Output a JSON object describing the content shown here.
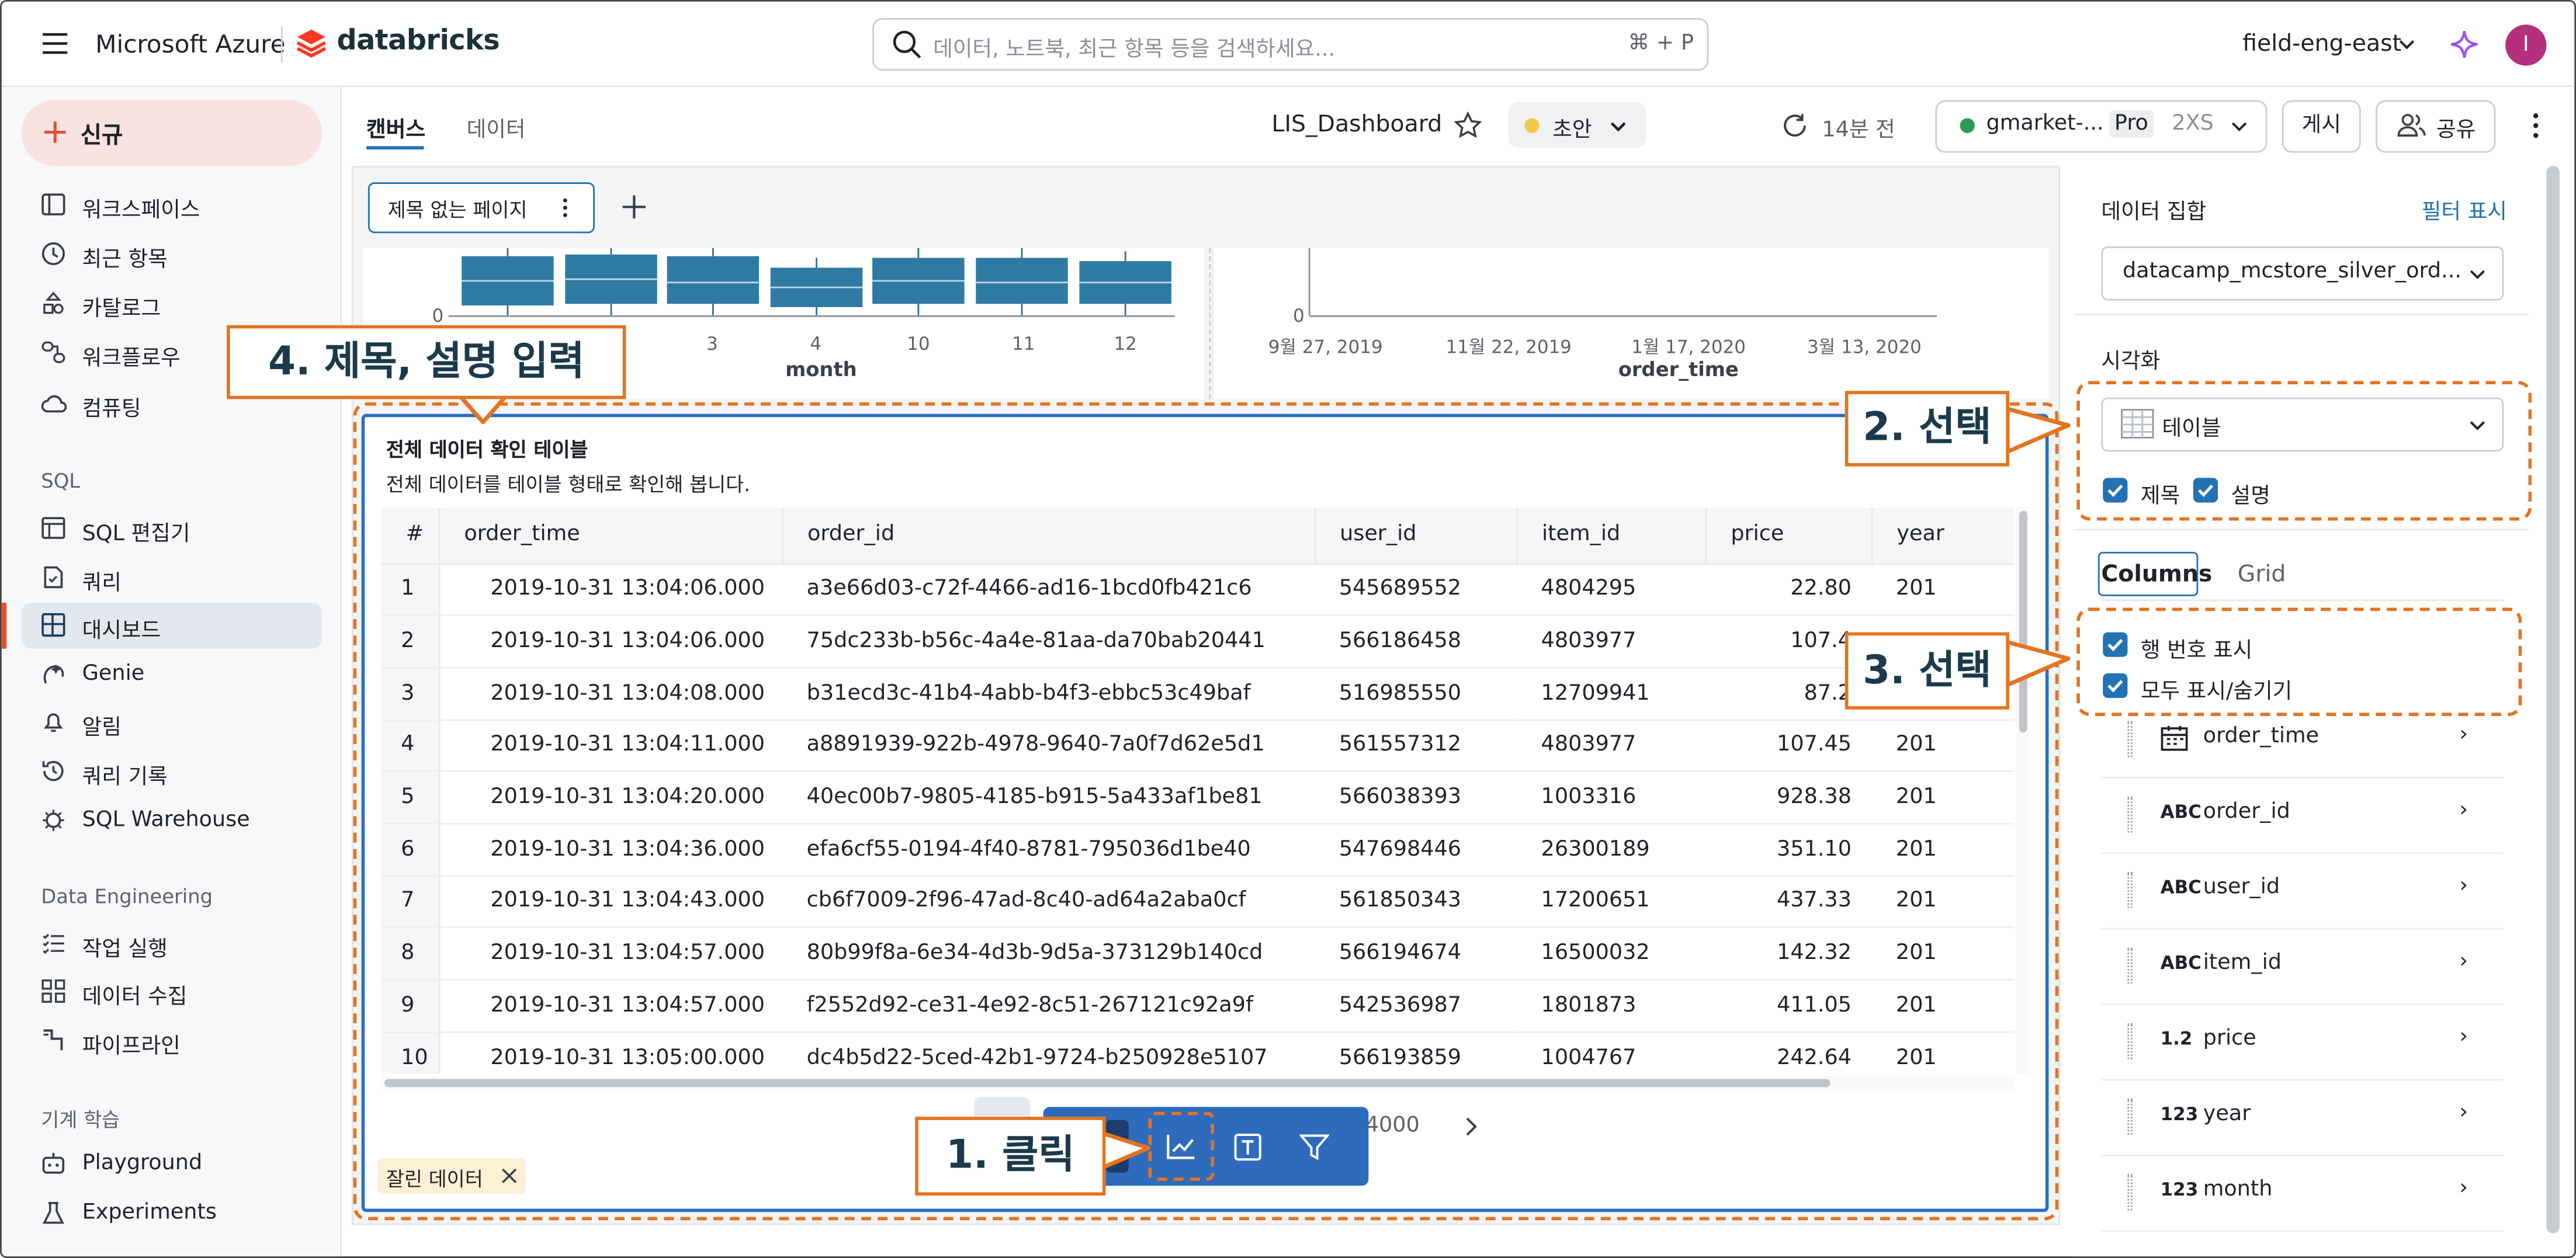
{
  "topbar": {
    "brand_azure": "Microsoft Azure",
    "brand_databricks": "databricks",
    "search_placeholder": "데이터, 노트북, 최근 항목 등을 검색하세요...",
    "search_shortcut": "⌘ + P",
    "workspace": "field-eng-east",
    "avatar_initial": "I"
  },
  "sidebar": {
    "new_label": "신규",
    "items_main": [
      {
        "label": "워크스페이스",
        "icon": "folder-icon"
      },
      {
        "label": "최근 항목",
        "icon": "clock-icon"
      },
      {
        "label": "카탈로그",
        "icon": "catalog-icon"
      },
      {
        "label": "워크플로우",
        "icon": "workflow-icon"
      },
      {
        "label": "컴퓨팅",
        "icon": "cloud-icon"
      }
    ],
    "section_sql": "SQL",
    "items_sql": [
      {
        "label": "SQL 편집기",
        "icon": "editor-icon"
      },
      {
        "label": "쿼리",
        "icon": "query-icon"
      },
      {
        "label": "대시보드",
        "icon": "dashboard-icon"
      },
      {
        "label": "Genie",
        "icon": "genie-icon"
      },
      {
        "label": "알림",
        "icon": "bell-icon"
      },
      {
        "label": "쿼리 기록",
        "icon": "history-icon"
      },
      {
        "label": "SQL Warehouse",
        "icon": "warehouse-icon"
      }
    ],
    "section_de": "Data Engineering",
    "items_de": [
      {
        "label": "작업 실행",
        "icon": "list-check-icon"
      },
      {
        "label": "데이터 수집",
        "icon": "ingest-icon"
      },
      {
        "label": "파이프라인",
        "icon": "pipeline-icon"
      }
    ],
    "section_ml": "기계 학습",
    "items_ml": [
      {
        "label": "Playground",
        "icon": "robot-icon"
      },
      {
        "label": "Experiments",
        "icon": "flask-icon"
      }
    ]
  },
  "header": {
    "tab_canvas": "캔버스",
    "tab_data": "데이터",
    "dashboard_title": "LIS_Dashboard",
    "draft_label": "초안",
    "refresh_label": "14분 전",
    "warehouse_name": "gmarket-...",
    "warehouse_tier": "Pro",
    "warehouse_size": "2XS",
    "publish_label": "게시",
    "share_label": "공유"
  },
  "canvas": {
    "page_tab_label": "제목 없는 페이지",
    "box_chart": {
      "x_label": "month",
      "x_ticks": [
        "3",
        "4",
        "10",
        "11",
        "12"
      ],
      "y_zero": "0"
    },
    "time_chart": {
      "x_label": "order_time",
      "x_ticks": [
        "9월 27, 2019",
        "11월 22, 2019",
        "1월 17, 2020",
        "3월 13, 2020"
      ],
      "y_zero": "0"
    },
    "table_widget": {
      "title": "전체 데이터 확인 테이블",
      "description": "전체 데이터를 테이블 형태로 확인해 봅니다.",
      "columns": [
        "#",
        "order_time",
        "order_id",
        "user_id",
        "item_id",
        "price",
        "year"
      ],
      "rows": [
        [
          "1",
          "2019-10-31 13:04:06.000",
          "a3e66d03-c72f-4466-ad16-1bcd0fb421c6",
          "545689552",
          "4804295",
          "22.80",
          "201"
        ],
        [
          "2",
          "2019-10-31 13:04:06.000",
          "75dc233b-b56c-4a4e-81aa-da70bab20441",
          "566186458",
          "4803977",
          "107.4",
          ""
        ],
        [
          "3",
          "2019-10-31 13:04:08.000",
          "b31ecd3c-41b4-4abb-b4f3-ebbc53c49baf",
          "516985550",
          "12709941",
          "87.2",
          ""
        ],
        [
          "4",
          "2019-10-31 13:04:11.000",
          "a8891939-922b-4978-9640-7a0f7d62e5d1",
          "561557312",
          "4803977",
          "107.45",
          "201"
        ],
        [
          "5",
          "2019-10-31 13:04:20.000",
          "40ec00b7-9805-4185-b915-5a433af1be81",
          "566038393",
          "1003316",
          "928.38",
          "201"
        ],
        [
          "6",
          "2019-10-31 13:04:36.000",
          "efa6cf55-0194-4f40-8781-795036d1be40",
          "547698446",
          "26300189",
          "351.10",
          "201"
        ],
        [
          "7",
          "2019-10-31 13:04:43.000",
          "cb6f7009-2f96-47ad-8c40-ad64a2aba0cf",
          "561850343",
          "17200651",
          "437.33",
          "201"
        ],
        [
          "8",
          "2019-10-31 13:04:57.000",
          "80b99f8a-6e34-4d3b-9d5a-373129b140cd",
          "566194674",
          "16500032",
          "142.32",
          "201"
        ],
        [
          "9",
          "2019-10-31 13:04:57.000",
          "f2552d92-ce31-4e92-8c51-267121c92a9f",
          "542536987",
          "1801873",
          "411.05",
          "201"
        ],
        [
          "10",
          "2019-10-31 13:05:00.000",
          "dc4b5d22-5ced-42b1-9724-b250928e5107",
          "566193859",
          "1004767",
          "242.64",
          "201"
        ]
      ],
      "pagination_partial": "4000",
      "filter_chip": "잘린 데이터"
    }
  },
  "right_panel": {
    "dataset_label": "데이터 집합",
    "filter_link": "필터 표시",
    "dataset_value": "datacamp_mcstore_silver_ord...",
    "viz_label": "시각화",
    "viz_value": "테이블",
    "check_title": "제목",
    "check_desc": "설명",
    "tab_columns": "Columns",
    "tab_grid": "Grid",
    "check_row_numbers": "행 번호 표시",
    "check_show_hide_all": "모두 표시/숨기기",
    "columns": [
      {
        "name": "order_time",
        "type_icon": "calendar-icon",
        "type_label": ""
      },
      {
        "name": "order_id",
        "type_icon": "string-type-icon",
        "type_label": "ABC"
      },
      {
        "name": "user_id",
        "type_icon": "string-type-icon",
        "type_label": "ABC"
      },
      {
        "name": "item_id",
        "type_icon": "string-type-icon",
        "type_label": "ABC"
      },
      {
        "name": "price",
        "type_icon": "decimal-type-icon",
        "type_label": "1.2"
      },
      {
        "name": "year",
        "type_icon": "integer-type-icon",
        "type_label": "123"
      },
      {
        "name": "month",
        "type_icon": "integer-type-icon",
        "type_label": "123"
      }
    ]
  },
  "annotations": {
    "step1": "1. 클릭",
    "step2": "2. 선택",
    "step3": "3. 선택",
    "step4": "4. 제목, 설명 입력"
  },
  "colors": {
    "accent_blue": "#2272b4",
    "annotation_orange": "#e4741f",
    "box_fill": "#2f7aa3",
    "new_button_bg": "#f8e2e2"
  }
}
